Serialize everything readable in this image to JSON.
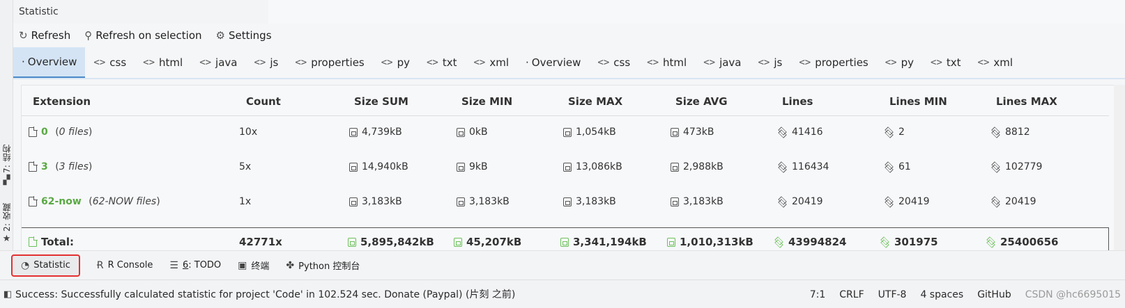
{
  "left_strip": {
    "tab_structure": {
      "label": "7: 结构",
      "icon": "structure-icon"
    },
    "tab_favorites": {
      "label": "2: 收藏",
      "icon": "star-icon"
    }
  },
  "window": {
    "title": "Statistic"
  },
  "toolbar": {
    "refresh_label": "Refresh",
    "refresh_selection_label": "Refresh on selection",
    "settings_label": "Settings"
  },
  "tabs": [
    {
      "label": "Overview",
      "icon": "dot",
      "active": true
    },
    {
      "label": "css",
      "icon": "code-icon"
    },
    {
      "label": "html",
      "icon": "code-icon"
    },
    {
      "label": "java",
      "icon": "code-icon"
    },
    {
      "label": "js",
      "icon": "code-icon"
    },
    {
      "label": "properties",
      "icon": "code-icon"
    },
    {
      "label": "py",
      "icon": "code-icon"
    },
    {
      "label": "txt",
      "icon": "code-icon"
    },
    {
      "label": "xml",
      "icon": "code-icon"
    },
    {
      "label": "Overview",
      "icon": "dot"
    },
    {
      "label": "css",
      "icon": "code-icon"
    },
    {
      "label": "html",
      "icon": "code-icon"
    },
    {
      "label": "java",
      "icon": "code-icon"
    },
    {
      "label": "js",
      "icon": "code-icon"
    },
    {
      "label": "properties",
      "icon": "code-icon"
    },
    {
      "label": "py",
      "icon": "code-icon"
    },
    {
      "label": "txt",
      "icon": "code-icon"
    },
    {
      "label": "xml",
      "icon": "code-icon"
    }
  ],
  "table": {
    "headers": {
      "extension": "Extension",
      "count": "Count",
      "size_sum": "Size SUM",
      "size_min": "Size MIN",
      "size_max": "Size MAX",
      "size_avg": "Size AVG",
      "lines": "Lines",
      "lines_min": "Lines MIN",
      "lines_max": "Lines MAX"
    },
    "rows": [
      {
        "ext": "0",
        "files": "0 files",
        "count": "10x",
        "size_sum": "4,739kB",
        "size_min": "0kB",
        "size_max": "1,054kB",
        "size_avg": "473kB",
        "lines": "41416",
        "lines_min": "2",
        "lines_max": "8812"
      },
      {
        "ext": "3",
        "files": "3 files",
        "count": "5x",
        "size_sum": "14,940kB",
        "size_min": "9kB",
        "size_max": "13,086kB",
        "size_avg": "2,988kB",
        "lines": "116434",
        "lines_min": "61",
        "lines_max": "102779"
      },
      {
        "ext": "62-now",
        "files": "62-NOW files",
        "count": "1x",
        "size_sum": "3,183kB",
        "size_min": "3,183kB",
        "size_max": "3,183kB",
        "size_avg": "3,183kB",
        "lines": "20419",
        "lines_min": "20419",
        "lines_max": "20419"
      }
    ],
    "total": {
      "label": "Total:",
      "count": "42771x",
      "size_sum": "5,895,842kB",
      "size_min": "45,207kB",
      "size_max": "3,341,194kB",
      "size_avg": "1,010,313kB",
      "lines": "43994824",
      "lines_min": "301975",
      "lines_max": "25400656"
    }
  },
  "bottom_tools": {
    "statistic": "Statistic",
    "r_console": "R Console",
    "todo_num": "6",
    "todo_label": ": TODO",
    "terminal": "终端",
    "python_console": "Python 控制台"
  },
  "status": {
    "message": "Success: Successfully calculated statistic for project 'Code' in 102.524 sec. Donate (Paypal) (片刻 之前)",
    "position": "7:1",
    "line_sep": "CRLF",
    "encoding": "UTF-8",
    "indent": "4 spaces",
    "vcs": "GitHub",
    "watermark": "CSDN @hc6695015"
  },
  "colors": {
    "accent_green": "#5aa945",
    "tab_active_bg": "#d4e4f5",
    "highlight_red": "#e53030"
  }
}
